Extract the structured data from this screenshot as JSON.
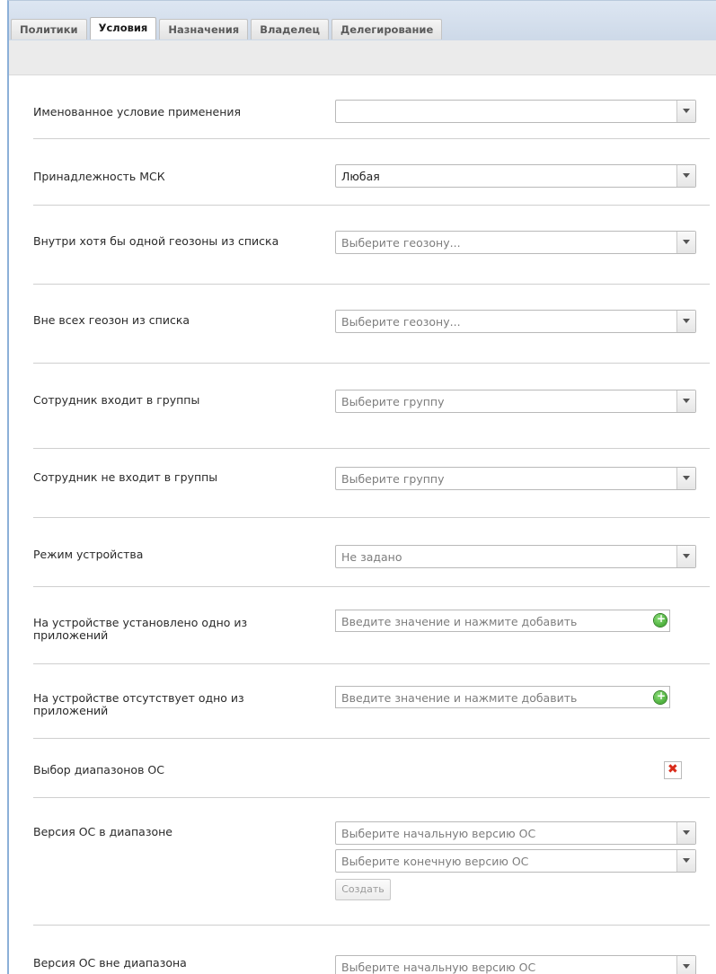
{
  "tabs": [
    "Политики",
    "Условия",
    "Назначения",
    "Владелец",
    "Делегирование"
  ],
  "active_tab": "Условия",
  "fields": {
    "named_condition": {
      "label": "Именованное условие применения",
      "value": ""
    },
    "msk": {
      "label": "Принадлежность МСК",
      "value": "Любая"
    },
    "inside_geozone": {
      "label": "Внутри хотя бы одной геозоны из списка",
      "placeholder": "Выберите геозону..."
    },
    "outside_geozone": {
      "label": "Вне всех геозон из списка",
      "placeholder": "Выберите геозону..."
    },
    "in_groups": {
      "label": "Сотрудник входит в группы",
      "placeholder": "Выберите группу"
    },
    "not_in_groups": {
      "label": "Сотрудник не входит в группы",
      "placeholder": "Выберите группу"
    },
    "device_mode": {
      "label": "Режим устройства",
      "value": "Не задано"
    },
    "app_installed": {
      "label": "На устройстве установлено одно из приложений",
      "placeholder": "Введите значение и нажмите добавить"
    },
    "app_missing": {
      "label": "На устройстве отсутствует одно из приложений",
      "placeholder": "Введите значение и нажмите добавить"
    },
    "os_ranges": {
      "label": "Выбор диапазонов ОС"
    },
    "os_in_range": {
      "label": "Версия ОС в диапазоне",
      "start_placeholder": "Выберите начальную версию ОС",
      "end_placeholder": "Выберите конечную версию ОС",
      "create_label": "Создать"
    },
    "os_out_range": {
      "label": "Версия ОС вне диапазона",
      "start_placeholder": "Выберите начальную версию ОС"
    }
  },
  "icons": {
    "add": "add-circle-icon",
    "delete": "delete-x-icon",
    "dropdown": "chevron-down-icon"
  },
  "colors": {
    "tab_border": "#8cb0d8",
    "add_green": "#2f9a1f",
    "delete_red": "#d92b1a"
  }
}
